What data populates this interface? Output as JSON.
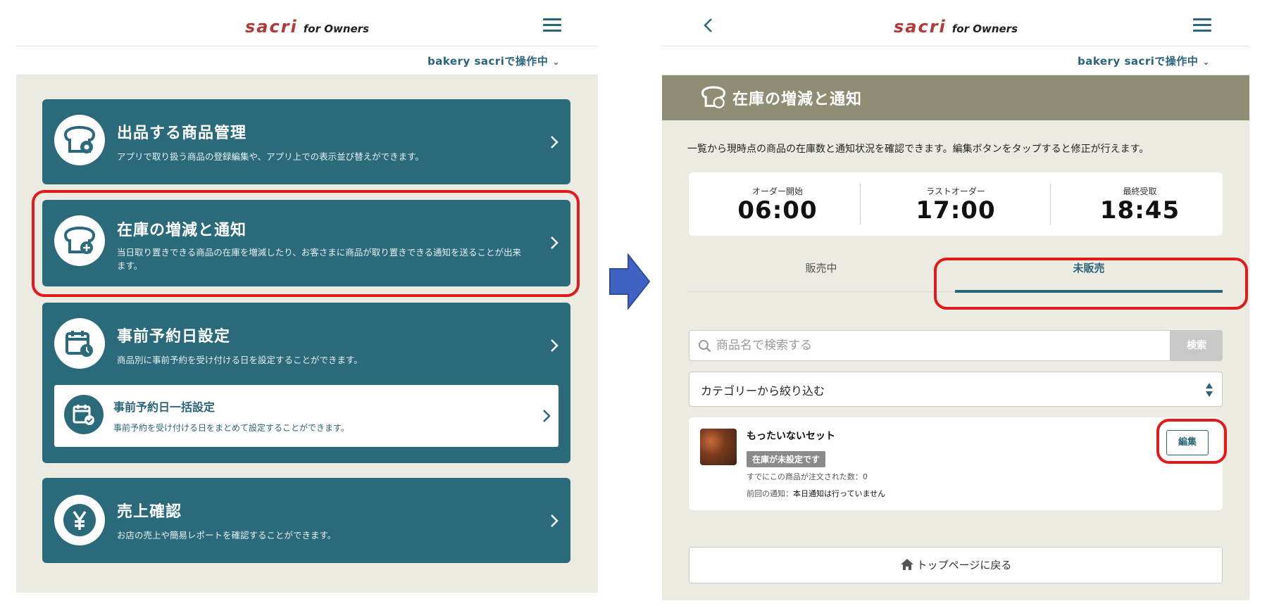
{
  "header": {
    "brand": "sacri",
    "brand_suffix": "for Owners"
  },
  "operating": {
    "label": "bakery sacriで操作中",
    "chevron": "⌄"
  },
  "left": {
    "cards": [
      {
        "title": "出品する商品管理",
        "desc": "アプリで取り扱う商品の登録編集や、アプリ上での表示並び替えができます。"
      },
      {
        "title": "在庫の増減と通知",
        "desc": "当日取り置きできる商品の在庫を増減したり、お客さまに商品が取り置きできる通知を送ることが出来ます。"
      },
      {
        "title": "事前予約日設定",
        "desc": "商品別に事前予約を受け付ける日を設定することができます。"
      },
      {
        "title": "売上確認",
        "desc": "お店の売上や簡易レポートを確認することができます。"
      }
    ],
    "subcard": {
      "title": "事前予約日一括設定",
      "desc": "事前予約を受け付ける日をまとめて設定することができます。"
    }
  },
  "right": {
    "page_title": "在庫の増減と通知",
    "intro": "一覧から現時点の商品の在庫数と通知状況を確認できます。編集ボタンをタップすると修正が行えます。",
    "times": [
      {
        "label": "オーダー開始",
        "value": "06:00"
      },
      {
        "label": "ラストオーダー",
        "value": "17:00"
      },
      {
        "label": "最終受取",
        "value": "18:45"
      }
    ],
    "tabs": [
      {
        "label": "販売中"
      },
      {
        "label": "未販売"
      }
    ],
    "active_tab": 1,
    "search": {
      "placeholder": "商品名で検索する",
      "button": "検索"
    },
    "category_select": {
      "value": "カテゴリーから絞り込む"
    },
    "item": {
      "name": "もったいないセット",
      "badge": "在庫が未設定です",
      "ordered": "すでにこの商品が注文された数：0",
      "notice_label": "前回の通知：",
      "notice_value": "本日通知は行っていません",
      "edit": "編集"
    },
    "top_button": "トップページに戻る"
  },
  "colors": {
    "teal": "#2a6a7a",
    "accent": "#2a6478",
    "header_olive": "#8f8e74",
    "background": "#ecebe1",
    "highlight": "#e11b1b",
    "arrow": "#3f63c2",
    "brand": "#b23a3a"
  }
}
